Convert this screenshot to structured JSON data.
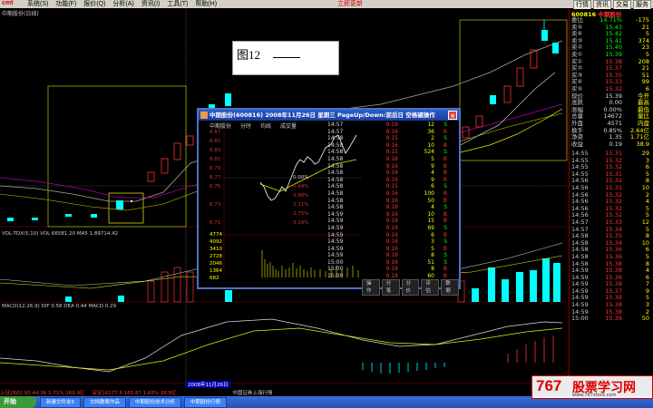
{
  "menubar": {
    "logo": "cmt",
    "items": [
      "系统(S)",
      "功能(F)",
      "报价(Q)",
      "分析(A)",
      "资讯(I)",
      "工具(T)",
      "帮助(H)"
    ],
    "promo": "立即更新",
    "right_buttons": [
      "行情",
      "资讯",
      "交易",
      "服务"
    ]
  },
  "chart": {
    "title": "中期股份(日线)"
  },
  "popup_note": {
    "text": "图12"
  },
  "subwindow": {
    "title": "中期股份(600816) 2008年11月26日 星期三 PageUp/Down:前后日 空格键操作",
    "tabs": [
      "中期股份",
      "分时",
      "均线",
      "成交量"
    ],
    "close": "×",
    "left_prices": [
      "8.87",
      "8.85",
      "8.83",
      "8.81",
      "8.79",
      "8.77",
      "8.75",
      "8.73",
      "8.71",
      "4774",
      "4092",
      "3410",
      "2728",
      "2046",
      "1364",
      "682"
    ],
    "footer_buttons": [
      "操作",
      "分笔",
      "分价",
      "评估",
      "数据"
    ],
    "ticks": [
      {
        "t": "14:57",
        "p": "9.16",
        "v": "12",
        "d": "S"
      },
      {
        "t": "14:57",
        "p": "9.16",
        "v": "36",
        "d": "B"
      },
      {
        "t": "14:58",
        "p": "9.15",
        "v": "2",
        "d": "S"
      },
      {
        "t": "14:58",
        "p": "9.16",
        "v": "10",
        "d": "B"
      },
      {
        "t": "14:58",
        "p": "9.15",
        "v": "524",
        "d": "S"
      },
      {
        "t": "14:58",
        "p": "9.16",
        "v": "5",
        "d": "B"
      },
      {
        "t": "14:58",
        "p": "9.16",
        "v": "9",
        "d": "B"
      },
      {
        "t": "14:58",
        "p": "9.16",
        "v": "4",
        "d": "B"
      },
      {
        "t": "14:58",
        "p": "9.16",
        "v": "9",
        "d": "B"
      },
      {
        "t": "14:58",
        "p": "9.15",
        "v": "6",
        "d": "S"
      },
      {
        "t": "14:58",
        "p": "9.16",
        "v": "100",
        "d": "B"
      },
      {
        "t": "14:58",
        "p": "9.16",
        "v": "50",
        "d": "B"
      },
      {
        "t": "14:58",
        "p": "9.16",
        "v": "4",
        "d": "S"
      },
      {
        "t": "14:59",
        "p": "9.16",
        "v": "10",
        "d": "B"
      },
      {
        "t": "14:59",
        "p": "9.16",
        "v": "15",
        "d": "B"
      },
      {
        "t": "14:59",
        "p": "9.16",
        "v": "69",
        "d": "S"
      },
      {
        "t": "14:59",
        "p": "9.16",
        "v": "6",
        "d": "B"
      },
      {
        "t": "14:59",
        "p": "9.16",
        "v": "3",
        "d": "S"
      },
      {
        "t": "14:59",
        "p": "9.16",
        "v": "5",
        "d": "B"
      },
      {
        "t": "14:59",
        "p": "9.16",
        "v": "8",
        "d": "S"
      },
      {
        "t": "15:00",
        "p": "9.16",
        "v": "51",
        "d": "S"
      },
      {
        "t": "15:00",
        "p": "9.16",
        "v": "8",
        "d": "B"
      },
      {
        "t": "15:00",
        "p": "9.18",
        "v": "60",
        "d": "B"
      }
    ],
    "pct_labels": [
      "0.00%",
      "0.44%",
      "0.88%",
      "2.31%",
      "2.75%",
      "3.19%",
      "3.63%",
      "4.07%",
      "4.51%"
    ]
  },
  "quote_panel": {
    "code": "600816",
    "name": "中期股份",
    "rows": [
      {
        "lab": "委比",
        "pr": "14.71%",
        "vo": "-175"
      },
      {
        "lab": "卖⑤",
        "pr": "15.43",
        "vo": "21"
      },
      {
        "lab": "卖④",
        "pr": "15.42",
        "vo": "5"
      },
      {
        "lab": "卖③",
        "pr": "15.41",
        "vo": "374"
      },
      {
        "lab": "卖②",
        "pr": "15.40",
        "vo": "23"
      },
      {
        "lab": "卖①",
        "pr": "15.39",
        "vo": "5"
      },
      {
        "lab": "买①",
        "pr": "15.38",
        "vo": "208"
      },
      {
        "lab": "买②",
        "pr": "15.37",
        "vo": "21"
      },
      {
        "lab": "买③",
        "pr": "15.35",
        "vo": "51"
      },
      {
        "lab": "买④",
        "pr": "15.33",
        "vo": "99"
      },
      {
        "lab": "买⑤",
        "pr": "15.32",
        "vo": "6"
      },
      {
        "lab": "现价",
        "pr": "15.39",
        "vo": "今开"
      },
      {
        "lab": "涨跌",
        "pr": "0.00",
        "vo": "最高"
      },
      {
        "lab": "涨幅",
        "pr": "0.00%",
        "vo": "最低"
      },
      {
        "lab": "总量",
        "pr": "14672",
        "vo": "量比"
      },
      {
        "lab": "外盘",
        "pr": "4571",
        "vo": "内盘"
      },
      {
        "lab": "换手",
        "pr": "0.85%",
        "vo": "2.64亿"
      },
      {
        "lab": "净资",
        "pr": "1.35",
        "vo": "1.71亿"
      },
      {
        "lab": "收益",
        "pr": "0.19",
        "vo": "38.9"
      }
    ],
    "ticks": [
      {
        "t": "14:55",
        "p": "15.31",
        "v": "29"
      },
      {
        "t": "14:55",
        "p": "15.32",
        "v": "3"
      },
      {
        "t": "14:55",
        "p": "15.32",
        "v": "6"
      },
      {
        "t": "14:55",
        "p": "15.31",
        "v": "5"
      },
      {
        "t": "14:56",
        "p": "15.32",
        "v": "8"
      },
      {
        "t": "14:56",
        "p": "15.31",
        "v": "10"
      },
      {
        "t": "14:56",
        "p": "15.32",
        "v": "2"
      },
      {
        "t": "14:56",
        "p": "15.32",
        "v": "4"
      },
      {
        "t": "14:56",
        "p": "15.32",
        "v": "5"
      },
      {
        "t": "14:56",
        "p": "15.32",
        "v": "5"
      },
      {
        "t": "14:57",
        "p": "15.33",
        "v": "12"
      },
      {
        "t": "14:57",
        "p": "15.34",
        "v": "5"
      },
      {
        "t": "14:58",
        "p": "15.35",
        "v": "8"
      },
      {
        "t": "14:58",
        "p": "15.34",
        "v": "10"
      },
      {
        "t": "14:58",
        "p": "15.36",
        "v": "6"
      },
      {
        "t": "14:58",
        "p": "15.36",
        "v": "5"
      },
      {
        "t": "14:58",
        "p": "15.38",
        "v": "8"
      },
      {
        "t": "14:59",
        "p": "15.38",
        "v": "4"
      },
      {
        "t": "14:59",
        "p": "15.36",
        "v": "6"
      },
      {
        "t": "14:59",
        "p": "15.38",
        "v": "7"
      },
      {
        "t": "14:59",
        "p": "15.37",
        "v": "9"
      },
      {
        "t": "14:59",
        "p": "15.39",
        "v": "5"
      },
      {
        "t": "14:59",
        "p": "15.38",
        "v": "3"
      },
      {
        "t": "14:59",
        "p": "15.38",
        "v": "2"
      },
      {
        "t": "15:00",
        "p": "15.39",
        "v": "50"
      }
    ]
  },
  "indicators": {
    "vol": "VOL-TDX(5,10) VOL 66581.20 MA5 1.89714.42",
    "macd": "MACD(12,26,9) DIF 0.58 DEA 0.44 MACD 0.29"
  },
  "date_label": "2008年11月26日",
  "statusbar": {
    "s1": "上证2602.93  44.36  1.71%  169.9亿",
    "s2": "深证10177.9  165.87  1.65%  38.8亿",
    "s3": "中国证券上海行情"
  },
  "taskbar": {
    "start": "开始",
    "tasks": [
      "新建文件夹5",
      "文档教案作品",
      "中期股份技术分析",
      "中期股份行情"
    ]
  },
  "watermark": {
    "num": "767",
    "txt": "股票学习网",
    "url": "www.767stock.com"
  }
}
